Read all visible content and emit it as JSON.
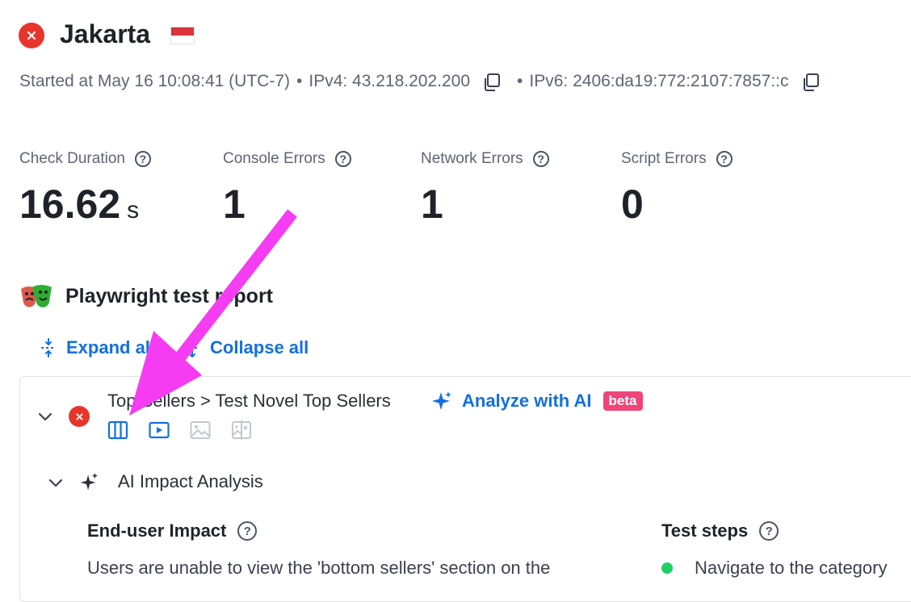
{
  "header": {
    "location": "Jakarta",
    "started_at": "Started at May 16 10:08:41 (UTC-7)",
    "separator": "•",
    "ipv4": "IPv4: 43.218.202.200",
    "ipv6": "IPv6: 2406:da19:772:2107:7857::c"
  },
  "stats": [
    {
      "label": "Check Duration",
      "value": "16.62",
      "unit": "s"
    },
    {
      "label": "Console Errors",
      "value": "1"
    },
    {
      "label": "Network Errors",
      "value": "1"
    },
    {
      "label": "Script Errors",
      "value": "0"
    }
  ],
  "report": {
    "title": "Playwright test report",
    "expand_all": "Expand all",
    "collapse_all": "Collapse all"
  },
  "test": {
    "title": "Top Sellers > Test Novel Top Sellers",
    "analyze": "Analyze with AI",
    "badge": "beta",
    "artifact_icons": [
      "trace-icon",
      "video-icon",
      "screenshot-icon",
      "image-compare-icon"
    ]
  },
  "analysis": {
    "title": "AI Impact Analysis",
    "impact_title": "End-user Impact",
    "impact_text": "Users are unable to view the 'bottom sellers' section on the",
    "steps_title": "Test steps",
    "steps": [
      "Navigate to the category"
    ]
  },
  "colors": {
    "error": "#e8352b",
    "link": "#1370e0",
    "beta": "#f0457a",
    "success": "#1fcf63",
    "annotation_arrow": "#f53cf2"
  }
}
